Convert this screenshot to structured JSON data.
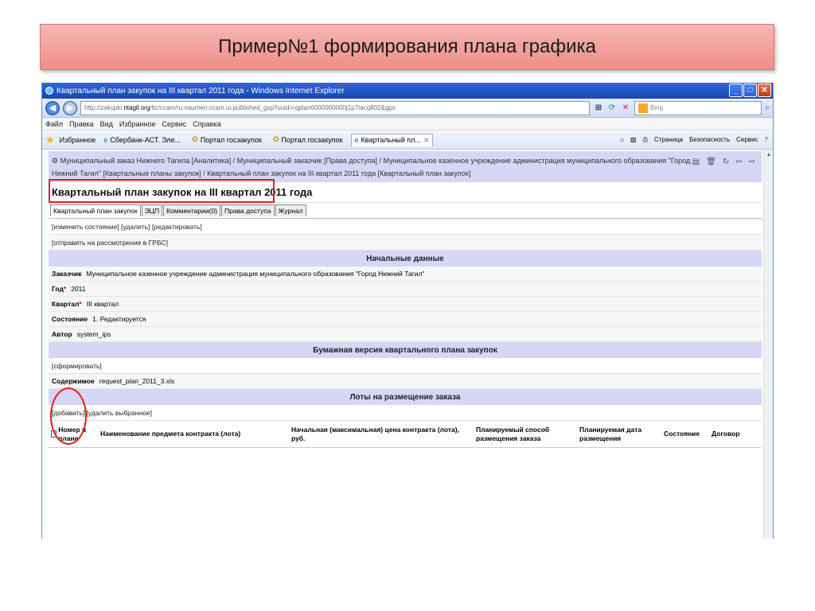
{
  "slide": {
    "title": "Пример№1 формирования плана графика"
  },
  "window": {
    "title": "Квартальный план закупок на III квартал 2011 года - Windows Internet Explorer"
  },
  "address": {
    "url_prefix": "http://zakupki.",
    "url_host": "ntagil.org",
    "url_rest": "/ltc/ccam/ru.naumen.ccam.ui.published_gsp?uuid=rqplan6000000000j1p7tacq802&gps",
    "search_placeholder": "Bing"
  },
  "menu": [
    "Файл",
    "Правка",
    "Вид",
    "Избранное",
    "Сервис",
    "Справка"
  ],
  "favorites": {
    "label": "Избранное",
    "tabs": [
      "Сбербанк-АСТ. Эле...",
      "Портал госзакупок",
      "Портал госзакупок",
      "Квартальный пл..."
    ],
    "right": [
      "Страница",
      "Безопасность",
      "Сервис"
    ]
  },
  "breadcrumb": "Муниципальный заказ Нижнего Тагила [Аналитика] / Муниципальный заказчик [Права доступа] / Муниципальное казенное учреждение администрация муниципального образования \"Город Нижний Тагил\" [Квартальные планы закупок] / Квартальный план закупок на III квартал 2011 года [Квартальный план закупок]",
  "page": {
    "title": "Квартальный план закупок на III квартал 2011 года",
    "tabs": [
      "Квартальный план закупок",
      "ЭЦП",
      "Комментарии(0)",
      "Права доступа",
      "Журнал"
    ],
    "actions1": "[изменить состояние] [удалить] [редактировать]",
    "actions2": "[отправить на рассмотрение в ГРБС]"
  },
  "initial": {
    "section": "Начальные данные",
    "customer_label": "Заказчик",
    "customer_value": "Муниципальное казенное учреждение администрация муниципального образования \"Город Нижний Тагил\"",
    "year_label": "Год",
    "year_value": "2011",
    "quarter_label": "Квартал",
    "quarter_value": "III квартал",
    "state_label": "Состояние",
    "state_value": "1. Редактируется",
    "author_label": "Автор",
    "author_value": "system_ips"
  },
  "paper": {
    "section": "Бумажная версия квартального плана закупок",
    "action": "[сформировать]",
    "content_label": "Содержимое",
    "content_value": "request_plan_2011_3.xls"
  },
  "lots": {
    "section": "Лоты на размещение заказа",
    "add": "[добавить]",
    "delete": "[удалить выбранное]",
    "columns": [
      "Номер в плане",
      "Наименование предмета контракта (лота)",
      "Начальная (максимальная) цена контракта (лота), руб.",
      "Планируемый способ размещения заказа",
      "Планируемая дата размещения",
      "Состояние",
      "Договор"
    ]
  }
}
